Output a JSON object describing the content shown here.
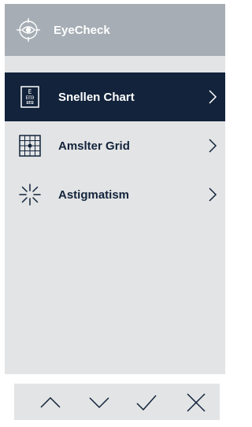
{
  "app": {
    "title": "EyeCheck",
    "logo_icon": "eye-crosshair-icon",
    "colors": {
      "header_bg": "#a6adb4",
      "panel_bg": "#e3e4e5",
      "active_bg": "#12233b",
      "text": "#12233b"
    }
  },
  "menu": {
    "items": [
      {
        "label": "Snellen Chart",
        "icon": "snellen-chart-icon",
        "active": true
      },
      {
        "label": "Amslter Grid",
        "icon": "amsler-grid-icon",
        "active": false
      },
      {
        "label": "Astigmatism",
        "icon": "astigmatism-icon",
        "active": false
      }
    ]
  },
  "nav": {
    "buttons": [
      {
        "name": "up",
        "icon": "chevron-up-icon"
      },
      {
        "name": "down",
        "icon": "chevron-down-icon"
      },
      {
        "name": "confirm",
        "icon": "check-icon"
      },
      {
        "name": "cancel",
        "icon": "close-icon"
      }
    ]
  }
}
